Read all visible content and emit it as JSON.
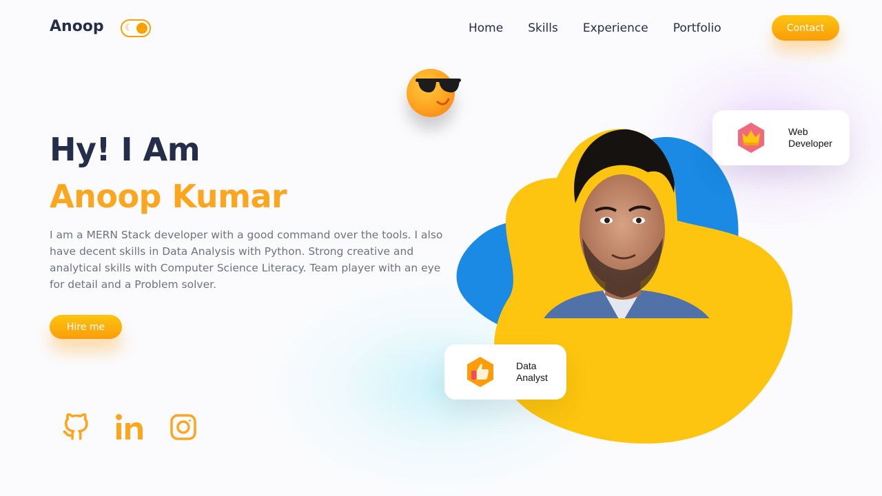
{
  "header": {
    "brand": "Anoop",
    "theme_toggle_icon": "moon-icon",
    "nav": [
      "Home",
      "Skills",
      "Experience",
      "Portfolio"
    ],
    "contact_label": "Contact"
  },
  "hero": {
    "greeting": "Hy! I Am",
    "name": "Anoop Kumar",
    "bio": "I am a MERN Stack developer with a good command over the tools. I also have decent skills in Data Analysis with Python. Strong creative and analytical skills with Computer Science Literacy. Team player with an eye for detail and a Problem solver.",
    "hire_label": "Hire me"
  },
  "socials": [
    "github-icon",
    "linkedin-icon",
    "instagram-icon"
  ],
  "cards": {
    "web": {
      "label_line1": "Web",
      "label_line2": "Developer",
      "icon": "crown-icon"
    },
    "data": {
      "label_line1": "Data",
      "label_line2": "Analyst",
      "icon": "thumbs-up-icon"
    }
  },
  "colors": {
    "accent": "#fca61f",
    "text": "#242d49",
    "blob_yellow": "#fdc50f",
    "blob_blue": "#1a8ae5"
  }
}
